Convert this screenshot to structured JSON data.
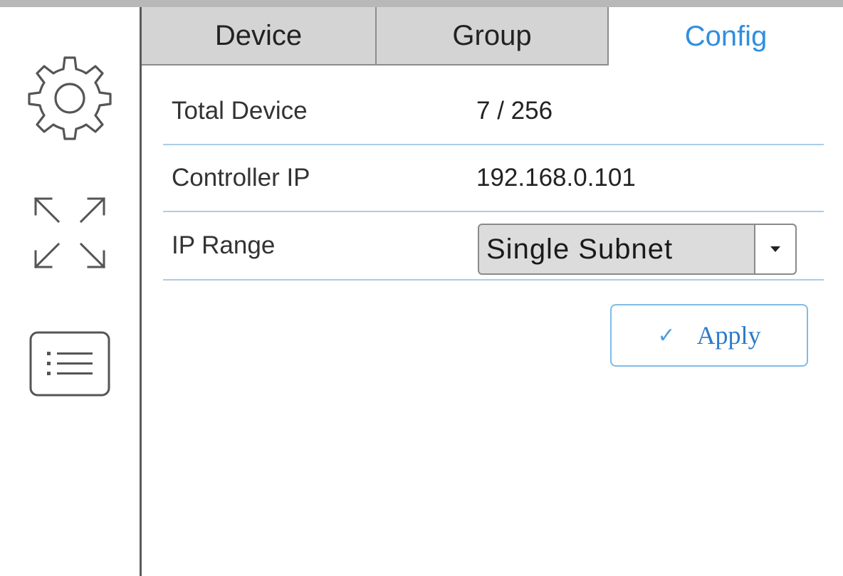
{
  "toolbar": {
    "icons": [
      "settings-gear-icon",
      "expand-arrows-icon",
      "list-icon"
    ]
  },
  "tabs": [
    {
      "label": "Device",
      "active": false
    },
    {
      "label": "Group",
      "active": false
    },
    {
      "label": "Config",
      "active": true
    }
  ],
  "config": {
    "total_device": {
      "label": "Total Device",
      "value": "7 / 256"
    },
    "controller_ip": {
      "label": "Controller IP",
      "value": "192.168.0.101"
    },
    "ip_range": {
      "label": "IP Range",
      "selected": "Single Subnet",
      "dropdown_icon": "caret-down-icon"
    },
    "apply_button": {
      "label": "Apply",
      "icon": "checkmark-icon"
    }
  },
  "colors": {
    "active_tab": "#2f8fe0",
    "inactive_tab_bg": "#d4d4d4",
    "divider": "#a9cde8",
    "apply_border": "#7fbce8",
    "apply_text": "#2a7bc8"
  }
}
